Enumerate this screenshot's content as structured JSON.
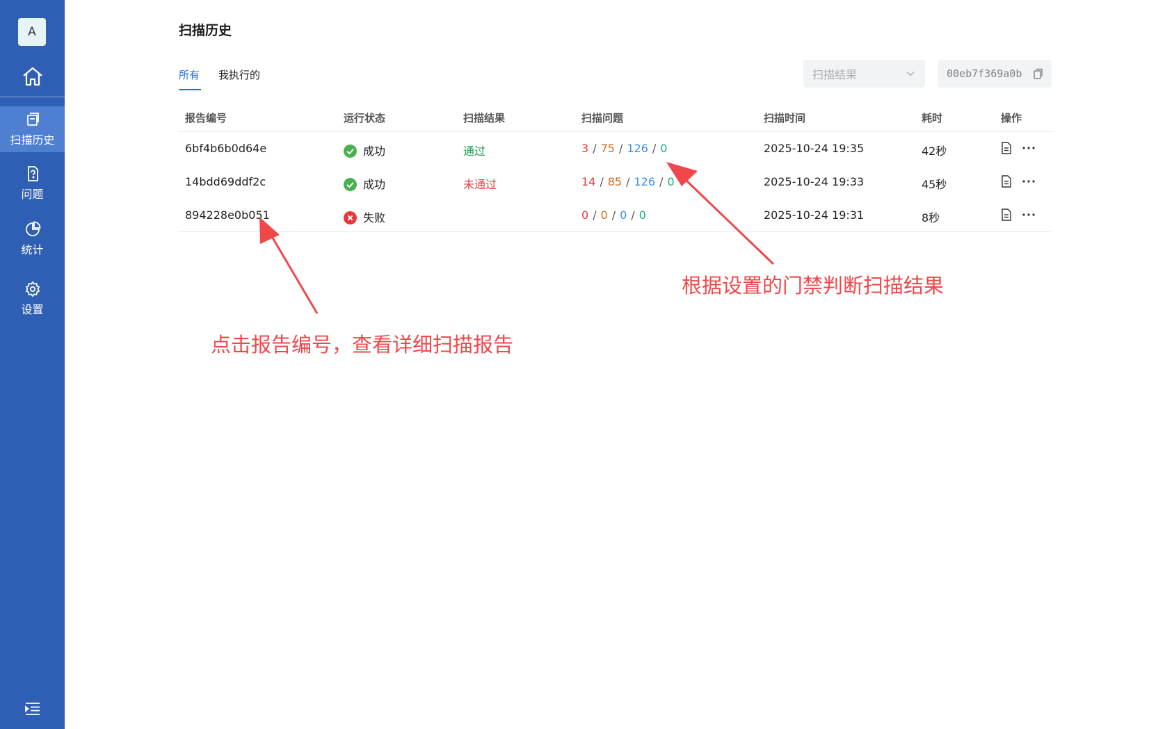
{
  "sidebar": {
    "avatar": "A",
    "items": [
      {
        "label": "扫描历史",
        "icon": "history-icon",
        "active": true
      },
      {
        "label": "问题",
        "icon": "question-doc-icon",
        "active": false
      },
      {
        "label": "统计",
        "icon": "pie-chart-icon",
        "active": false
      },
      {
        "label": "设置",
        "icon": "gear-icon",
        "active": false
      }
    ],
    "collapse_icon": "collapse-menu-icon",
    "home_icon": "home-icon"
  },
  "page": {
    "title": "扫描历史",
    "tabs": [
      {
        "label": "所有",
        "active": true
      },
      {
        "label": "我执行的",
        "active": false
      }
    ]
  },
  "filters": {
    "result_placeholder": "扫描结果",
    "commit_hash": "00eb7f369a0b"
  },
  "table": {
    "headers": [
      "报告编号",
      "运行状态",
      "扫描结果",
      "扫描问题",
      "扫描时间",
      "耗时",
      "操作"
    ],
    "rows": [
      {
        "id": "6bf4b6b0d64e",
        "status": "成功",
        "status_ok": true,
        "result": "通过",
        "result_ok": true,
        "issues": [
          "3",
          "75",
          "126",
          "0"
        ],
        "time": "2025-10-24 19:35",
        "duration": "42秒"
      },
      {
        "id": "14bdd69ddf2c",
        "status": "成功",
        "status_ok": true,
        "result": "未通过",
        "result_ok": false,
        "issues": [
          "14",
          "85",
          "126",
          "0"
        ],
        "time": "2025-10-24 19:33",
        "duration": "45秒"
      },
      {
        "id": "894228e0b051",
        "status": "失败",
        "status_ok": false,
        "result": "",
        "result_ok": null,
        "issues": [
          "0",
          "0",
          "0",
          "0"
        ],
        "time": "2025-10-24 19:31",
        "duration": "8秒"
      }
    ]
  },
  "annotations": {
    "gate_note": "根据设置的门禁判断扫描结果",
    "report_note": "点击报告编号，查看详细扫描报告"
  },
  "colors": {
    "sidebar": "#2f5fb4",
    "accent": "#2f6fd6",
    "success": "#4caf50",
    "error": "#e53935",
    "annotation": "#f0484a"
  }
}
